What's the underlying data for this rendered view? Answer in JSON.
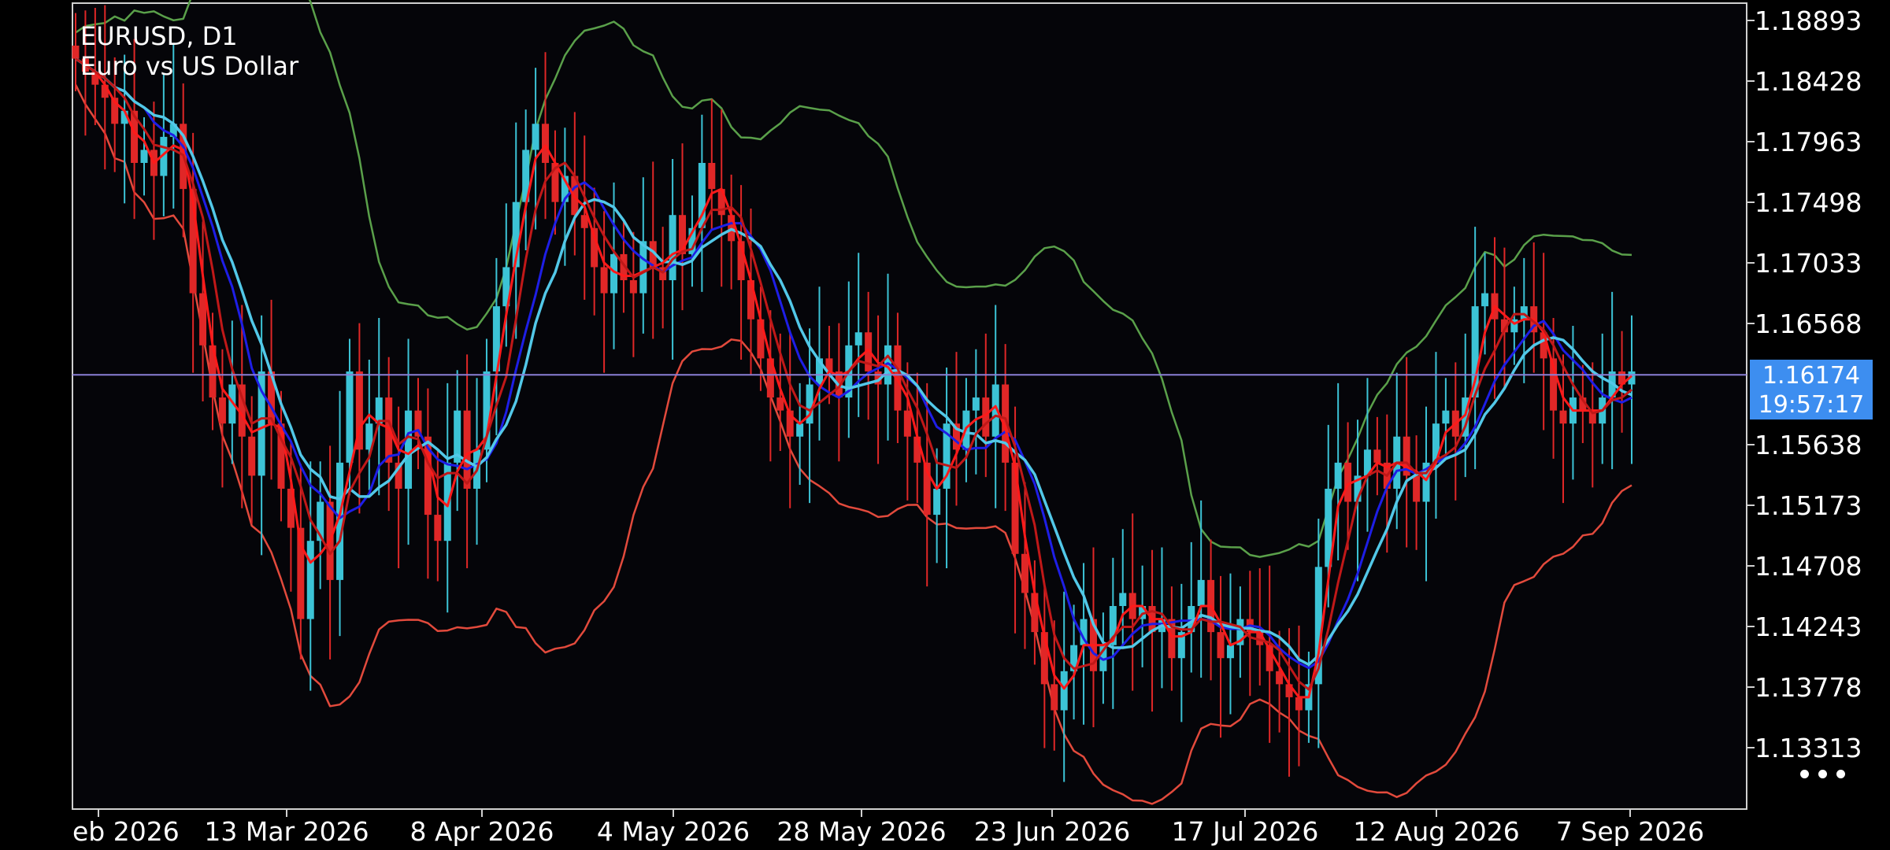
{
  "symbol": "EURUSD, D1",
  "description": "Euro vs US Dollar",
  "current_price": "1.16174",
  "countdown": "19:57:17",
  "colors": {
    "bull": "#3cc3d6",
    "bear": "#e02727",
    "ma_fast": "#ff1a1a",
    "ma_mid": "#c01818",
    "ma_blue": "#1e1ee6",
    "ma_cyan": "#52c8e8",
    "bb_upper": "#5aa04a",
    "bb_lower": "#e24a3c",
    "price_line": "#8a7fd6",
    "badge": "#3d8ef0"
  },
  "chart_data": {
    "type": "candlestick",
    "title": "EURUSD, D1",
    "subtitle": "Euro vs US Dollar",
    "ylim": [
      1.1313,
      1.1898
    ],
    "y_ticks": [
      "1.18893",
      "1.18428",
      "1.17963",
      "1.17498",
      "1.17033",
      "1.16568",
      "1.16174",
      "1.15638",
      "1.15173",
      "1.14708",
      "1.14243",
      "1.13778",
      "1.13313"
    ],
    "x_ticks": [
      "eb 2026",
      "13 Mar 2026",
      "8 Apr 2026",
      "4 May 2026",
      "28 May 2026",
      "23 Jun 2026",
      "17 Jul 2026",
      "12 Aug 2026",
      "7 Sep 2026"
    ],
    "last_price": 1.16174,
    "close": [
      1.186,
      1.185,
      1.184,
      1.183,
      1.181,
      1.182,
      1.178,
      1.179,
      1.177,
      1.18,
      1.181,
      1.176,
      1.168,
      1.164,
      1.16,
      1.158,
      1.161,
      1.157,
      1.154,
      1.162,
      1.158,
      1.153,
      1.15,
      1.143,
      1.149,
      1.152,
      1.146,
      1.155,
      1.162,
      1.156,
      1.158,
      1.16,
      1.155,
      1.153,
      1.159,
      1.157,
      1.151,
      1.149,
      1.155,
      1.159,
      1.153,
      1.156,
      1.162,
      1.167,
      1.17,
      1.175,
      1.179,
      1.181,
      1.178,
      1.175,
      1.177,
      1.174,
      1.173,
      1.17,
      1.168,
      1.171,
      1.169,
      1.168,
      1.172,
      1.17,
      1.169,
      1.174,
      1.171,
      1.173,
      1.178,
      1.176,
      1.174,
      1.172,
      1.169,
      1.166,
      1.163,
      1.16,
      1.159,
      1.157,
      1.158,
      1.161,
      1.163,
      1.162,
      1.16,
      1.164,
      1.165,
      1.162,
      1.161,
      1.164,
      1.159,
      1.157,
      1.155,
      1.151,
      1.153,
      1.158,
      1.156,
      1.159,
      1.16,
      1.157,
      1.161,
      1.155,
      1.148,
      1.145,
      1.142,
      1.138,
      1.136,
      1.139,
      1.141,
      1.143,
      1.139,
      1.141,
      1.144,
      1.145,
      1.143,
      1.144,
      1.142,
      1.143,
      1.14,
      1.142,
      1.144,
      1.146,
      1.142,
      1.14,
      1.141,
      1.143,
      1.142,
      1.141,
      1.139,
      1.138,
      1.137,
      1.136,
      1.138,
      1.147,
      1.153,
      1.155,
      1.152,
      1.154,
      1.156,
      1.155,
      1.153,
      1.157,
      1.154,
      1.152,
      1.155,
      1.158,
      1.159,
      1.157,
      1.16,
      1.167,
      1.168,
      1.166,
      1.165,
      1.166,
      1.167,
      1.165,
      1.163,
      1.159,
      1.158,
      1.16,
      1.159,
      1.158,
      1.16,
      1.162,
      1.161,
      1.162
    ]
  }
}
